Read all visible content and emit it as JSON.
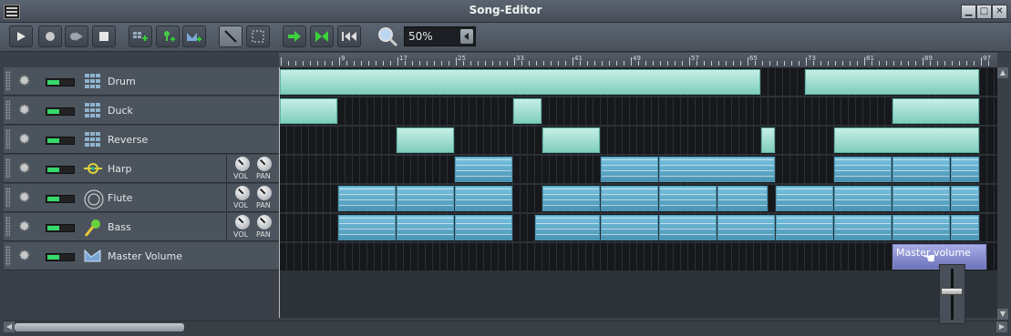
{
  "window": {
    "title": "Song-Editor",
    "buttons": [
      "▁",
      "□",
      "✕"
    ]
  },
  "toolbar": {
    "buttons": [
      {
        "name": "play-button",
        "glyph": "▶"
      },
      {
        "name": "record-button",
        "glyph": "●"
      },
      {
        "name": "record-play-button",
        "glyph": "⏺"
      },
      {
        "name": "stop-button",
        "glyph": "■"
      },
      {
        "name": "add-beat-bassline-button",
        "glyph": "⊞"
      },
      {
        "name": "add-sample-track-button",
        "glyph": "♣"
      },
      {
        "name": "add-automation-track-button",
        "glyph": "◣"
      },
      {
        "name": "draw-mode-button",
        "glyph": "╲"
      },
      {
        "name": "edit-mode-button",
        "glyph": "⬚"
      },
      {
        "name": "auto-scroll-button",
        "glyph": "➜"
      },
      {
        "name": "loop-points-button",
        "glyph": "⋈"
      },
      {
        "name": "back-to-start-button",
        "glyph": "⏮"
      }
    ],
    "zoom_icon": "magnifier-icon",
    "zoom_value": "50%"
  },
  "timeline": {
    "bar_labels": [
      "9",
      "17",
      "25",
      "33",
      "41",
      "49",
      "57",
      "65",
      "73",
      "81",
      "89",
      "97"
    ]
  },
  "tracks": [
    {
      "name": "Drum",
      "icon": "beat-bassline-icon",
      "has_knobs": false
    },
    {
      "name": "Duck",
      "icon": "beat-bassline-icon",
      "has_knobs": false
    },
    {
      "name": "Reverse",
      "icon": "beat-bassline-icon",
      "has_knobs": false
    },
    {
      "name": "Harp",
      "icon": "harp-icon",
      "has_knobs": true
    },
    {
      "name": "Flute",
      "icon": "flute-icon",
      "has_knobs": true
    },
    {
      "name": "Bass",
      "icon": "bass-icon",
      "has_knobs": true
    },
    {
      "name": "Master Volume",
      "icon": "automation-icon",
      "has_knobs": false
    }
  ],
  "knob_labels": {
    "vol": "VOL",
    "pan": "PAN"
  },
  "clips": [
    [
      {
        "start": 1,
        "len": 66,
        "type": "bb"
      },
      {
        "start": 73,
        "len": 24,
        "type": "bb"
      }
    ],
    [
      {
        "start": 1,
        "len": 8,
        "type": "bb"
      },
      {
        "start": 33,
        "len": 4,
        "type": "bb"
      },
      {
        "start": 85,
        "len": 12,
        "type": "bb"
      }
    ],
    [
      {
        "start": 17,
        "len": 8,
        "type": "bb"
      },
      {
        "start": 37,
        "len": 8,
        "type": "bb"
      },
      {
        "start": 67,
        "len": 2,
        "type": "bb"
      },
      {
        "start": 77,
        "len": 20,
        "type": "bb"
      }
    ],
    [
      {
        "start": 25,
        "len": 8,
        "type": "inst"
      },
      {
        "start": 45,
        "len": 8,
        "type": "inst"
      },
      {
        "start": 53,
        "len": 16,
        "type": "inst"
      },
      {
        "start": 77,
        "len": 8,
        "type": "inst"
      },
      {
        "start": 85,
        "len": 8,
        "type": "inst"
      },
      {
        "start": 93,
        "len": 4,
        "type": "inst"
      }
    ],
    [
      {
        "start": 9,
        "len": 8,
        "type": "inst"
      },
      {
        "start": 17,
        "len": 8,
        "type": "inst"
      },
      {
        "start": 25,
        "len": 8,
        "type": "inst"
      },
      {
        "start": 37,
        "len": 8,
        "type": "inst"
      },
      {
        "start": 45,
        "len": 8,
        "type": "inst"
      },
      {
        "start": 53,
        "len": 8,
        "type": "inst"
      },
      {
        "start": 61,
        "len": 7,
        "type": "inst"
      },
      {
        "start": 69,
        "len": 8,
        "type": "inst"
      },
      {
        "start": 77,
        "len": 8,
        "type": "inst"
      },
      {
        "start": 85,
        "len": 8,
        "type": "inst"
      },
      {
        "start": 93,
        "len": 4,
        "type": "inst"
      }
    ],
    [
      {
        "start": 9,
        "len": 8,
        "type": "inst"
      },
      {
        "start": 17,
        "len": 8,
        "type": "inst"
      },
      {
        "start": 25,
        "len": 8,
        "type": "inst"
      },
      {
        "start": 36,
        "len": 9,
        "type": "inst"
      },
      {
        "start": 45,
        "len": 8,
        "type": "inst"
      },
      {
        "start": 53,
        "len": 8,
        "type": "inst"
      },
      {
        "start": 61,
        "len": 8,
        "type": "inst"
      },
      {
        "start": 69,
        "len": 8,
        "type": "inst"
      },
      {
        "start": 77,
        "len": 8,
        "type": "inst"
      },
      {
        "start": 85,
        "len": 8,
        "type": "inst"
      },
      {
        "start": 93,
        "len": 4,
        "type": "inst"
      }
    ],
    [
      {
        "start": 85,
        "len": 13,
        "type": "auto",
        "label": "Master volume"
      }
    ]
  ]
}
